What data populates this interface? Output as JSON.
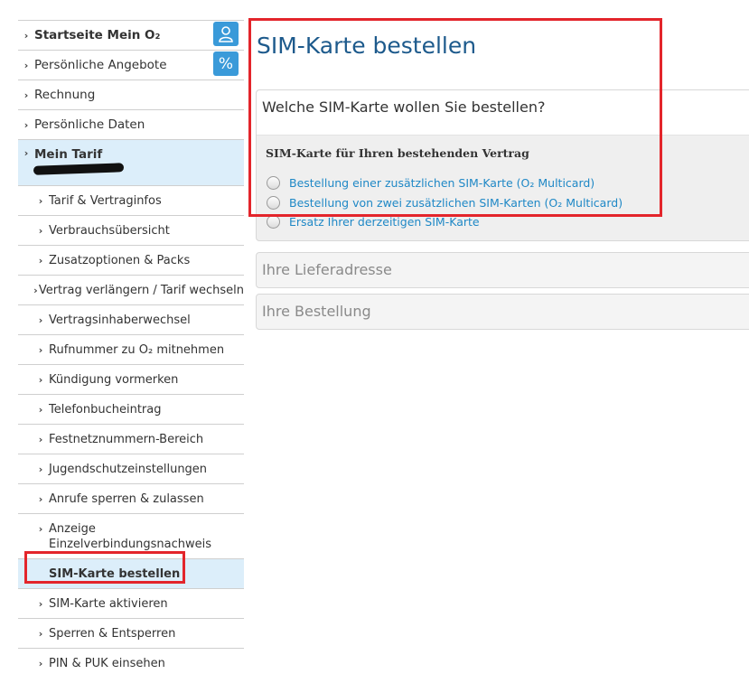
{
  "sidebar": {
    "top_items": [
      {
        "label": "Startseite Mein O₂",
        "bold": true
      },
      {
        "label": "Persönliche Angebote",
        "bold": false
      },
      {
        "label": "Rechnung",
        "bold": false
      },
      {
        "label": "Persönliche Daten",
        "bold": false
      }
    ],
    "section": {
      "label": "Mein Tarif"
    },
    "sub_items": [
      "Tarif & Vertraginfos",
      "Verbrauchsübersicht",
      "Zusatzoptionen & Packs",
      "Vertrag verlängern / Tarif wechseln",
      "Vertragsinhaberwechsel",
      "Rufnummer zu O₂ mitnehmen",
      "Kündigung vormerken",
      "Telefonbucheintrag",
      "Festnetznummern-Bereich",
      "Jugendschutzeinstellungen",
      "Anrufe sperren & zulassen",
      "Anzeige Einzelverbindungsnachweis",
      "SIM-Karte bestellen",
      "SIM-Karte aktivieren",
      "Sperren & Entsperren",
      "PIN & PUK einsehen"
    ],
    "active_item": "SIM-Karte bestellen",
    "icons": [
      "person-icon",
      "percent-icon"
    ],
    "icon_glyphs": {
      "person": "👤",
      "percent": "%"
    }
  },
  "main": {
    "title": "SIM-Karte bestellen",
    "question": "Welche SIM-Karte wollen Sie bestellen?",
    "subheading": "SIM-Karte für Ihren bestehenden Vertrag",
    "options": [
      "Bestellung einer zusätzlichen SIM-Karte (O₂ Multicard)",
      "Bestellung von zwei zusätzlichen SIM-Karten (O₂ Multicard)",
      "Ersatz Ihrer derzeitigen SIM-Karte"
    ],
    "sections": [
      "Ihre Lieferadresse",
      "Ihre Bestellung"
    ]
  },
  "colors": {
    "brand_blue": "#3a9ad9",
    "title_blue": "#1d5a8c",
    "link_blue": "#1f88c6",
    "active_bg": "#dceefa",
    "highlight_red": "#e3252b"
  }
}
